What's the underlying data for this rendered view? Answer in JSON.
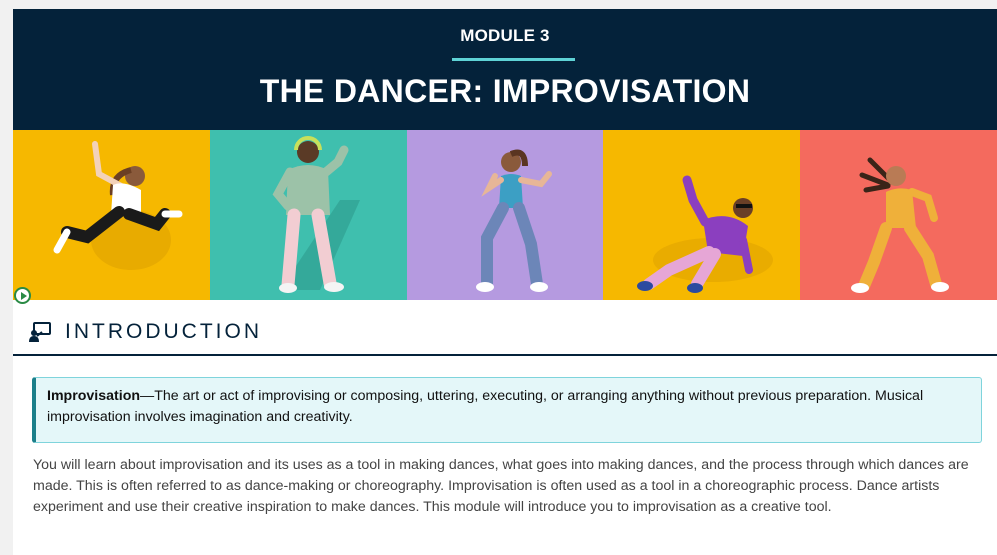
{
  "banner": {
    "module_label": "MODULE 3",
    "title": "THE DANCER: IMPROVISATION",
    "background": "#04223a",
    "accent": "#5fd3d6"
  },
  "hero": {
    "panels": [
      {
        "name": "dancer-jumping",
        "bg": "#f6b800"
      },
      {
        "name": "dancer-headphones",
        "bg": "#3fbfae"
      },
      {
        "name": "dancer-posing",
        "bg": "#b59ae0"
      },
      {
        "name": "dancer-breakdance",
        "bg": "#f6b800"
      },
      {
        "name": "dancer-hair-flip",
        "bg": "#f46a5e"
      }
    ]
  },
  "intro": {
    "icon": "presentation-icon",
    "heading": "INTRODUCTION"
  },
  "callout": {
    "term": "Improvisation",
    "definition": "—The art or act of improvising or composing, uttering, executing, or arranging anything without previous preparation. Musical improvisation involves imagination and creativity."
  },
  "body": {
    "paragraph": "You will learn about improvisation and its uses as a tool in making dances, what goes into making dances, and the process through which dances are made. This is often referred to as dance-making or choreography. Improvisation is often used as a tool in a choreographic process. Dance artists experiment and use their creative inspiration to make dances. This module will introduce you to improvisation as a creative tool."
  }
}
